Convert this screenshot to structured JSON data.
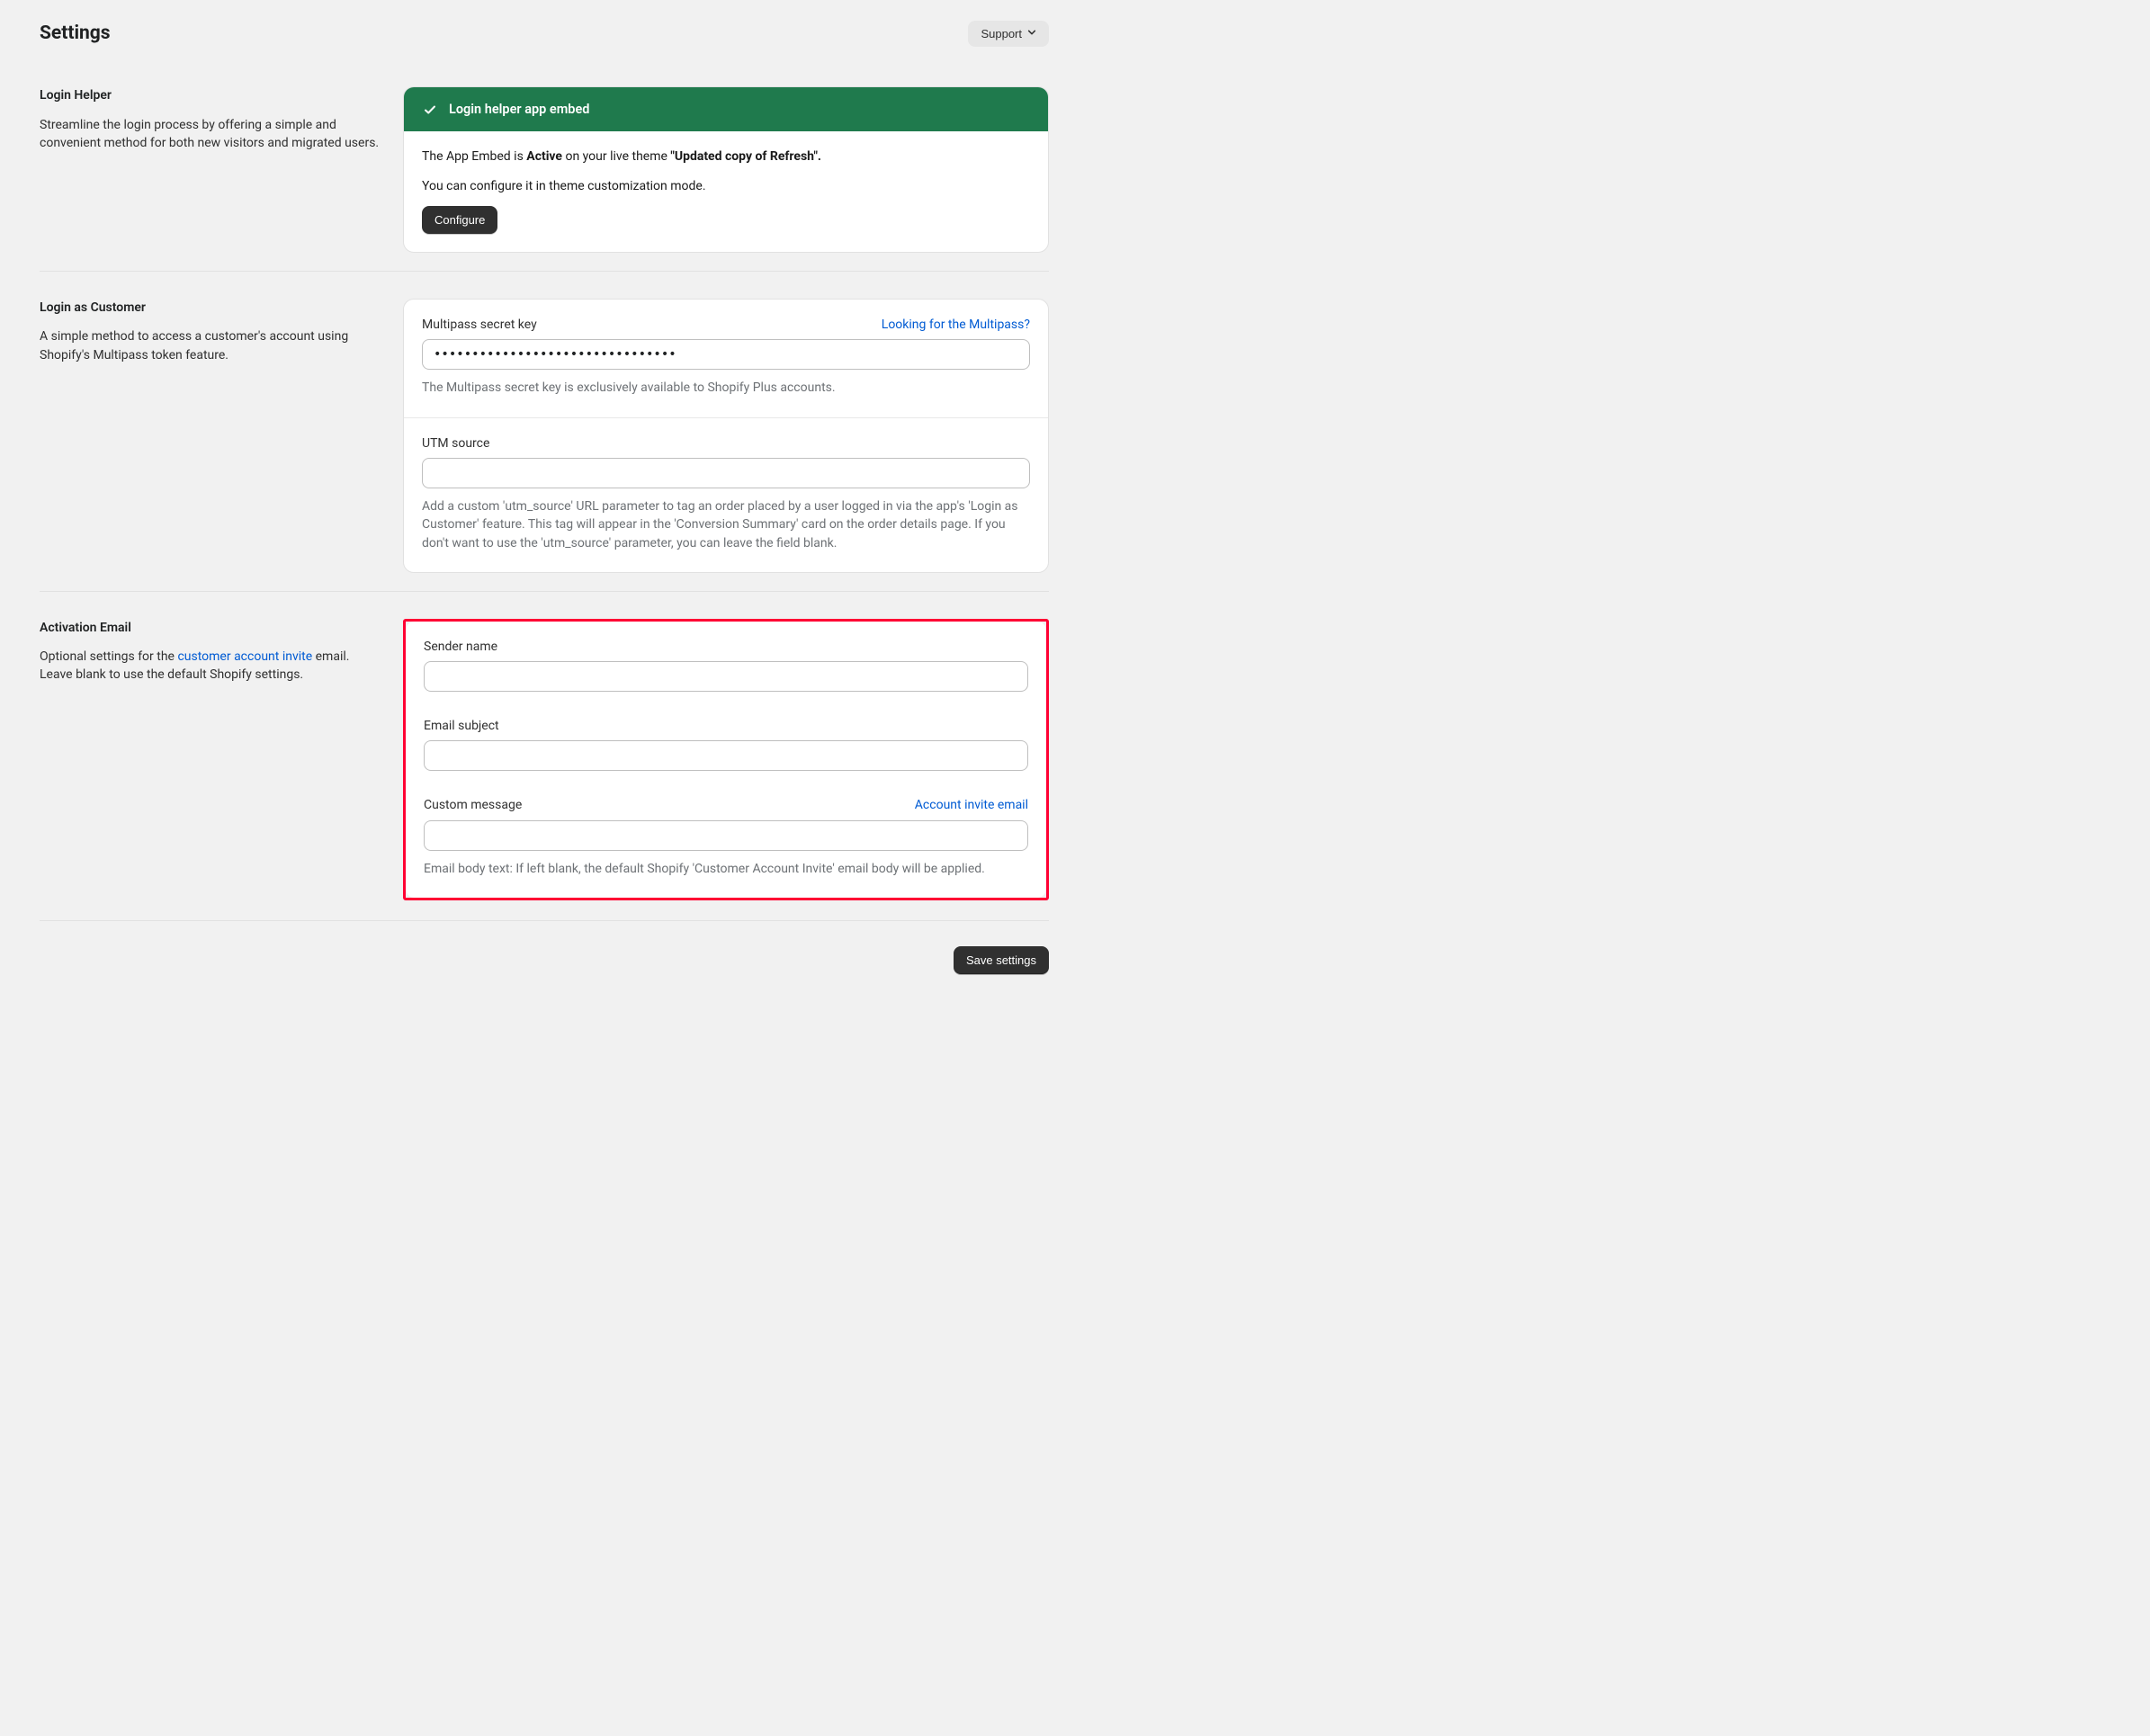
{
  "header": {
    "title": "Settings",
    "support_label": "Support"
  },
  "section1": {
    "title": "Login Helper",
    "desc": "Streamline the login process by offering a simple and convenient method for both new visitors and migrated users.",
    "banner_title": "Login helper app embed",
    "body_prefix": "The App Embed is ",
    "status_word": "Active",
    "body_mid": " on your live theme ",
    "theme_quote_open": "\"",
    "theme_name": "Updated copy of Refresh",
    "theme_quote_close": "\".",
    "configure_line": "You can configure it in theme customization mode.",
    "configure_btn": "Configure"
  },
  "section2": {
    "title": "Login as Customer",
    "desc": "A simple method to access a customer's account using Shopify's Multipass token feature.",
    "multipass_label": "Multipass secret key",
    "multipass_link": "Looking for the Multipass?",
    "multipass_value": "••••••••••••••••••••••••••••••••",
    "multipass_help": "The Multipass secret key is exclusively available to Shopify Plus accounts.",
    "utm_label": "UTM source",
    "utm_value": "",
    "utm_help": "Add a custom 'utm_source' URL parameter to tag an order placed by a user logged in via the app's 'Login as Customer' feature. This tag will appear in the 'Conversion Summary' card on the order details page. If you don't want to use the 'utm_source' parameter, you can leave the field blank."
  },
  "section3": {
    "title": "Activation Email",
    "desc_prefix": "Optional settings for the ",
    "desc_link": "customer account invite",
    "desc_suffix": " email. Leave blank to use the default Shopify settings.",
    "sender_label": "Sender name",
    "sender_value": "",
    "subject_label": "Email subject",
    "subject_value": "",
    "custom_label": "Custom message",
    "custom_link": "Account invite email",
    "custom_value": "",
    "custom_help": "Email body text: If left blank, the default Shopify 'Customer Account Invite' email body will be applied."
  },
  "footer": {
    "save_label": "Save settings"
  }
}
